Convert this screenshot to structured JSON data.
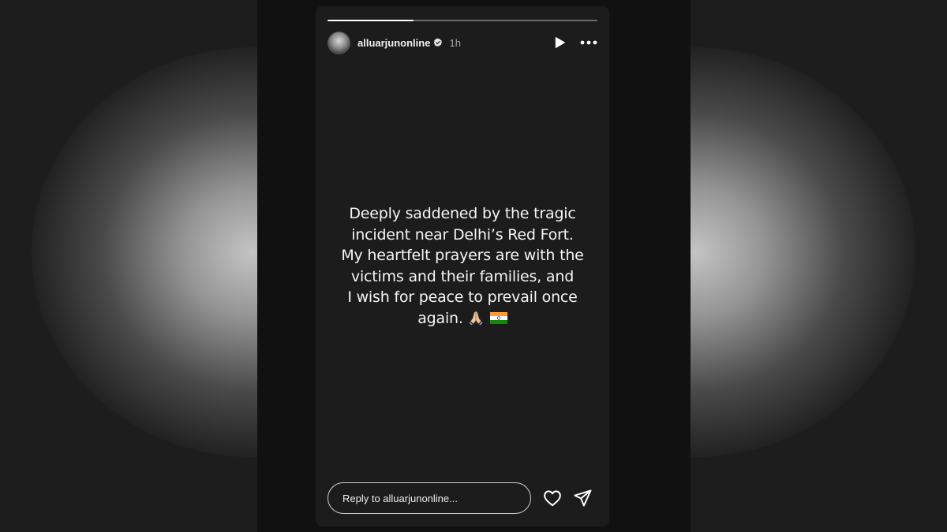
{
  "story": {
    "username": "alluarjunonline",
    "time_ago": "1h",
    "progress": 0.32,
    "text_lines": [
      "Deeply saddened by the tragic",
      "incident near Delhi’s Red Fort.",
      "My heartfelt prayers are with the",
      "victims and their families, and",
      "I wish for peace to prevail once",
      "again."
    ],
    "emojis": [
      "folded-hands",
      "india-flag"
    ]
  },
  "reply": {
    "placeholder": "Reply to alluarjunonline..."
  },
  "icons": {
    "play": "play-icon",
    "more": "more-options-icon",
    "like": "heart-icon",
    "share": "send-icon",
    "verified": "verified-badge-icon"
  },
  "colors": {
    "background": "#1c1c1c",
    "story_background": "#1c1c1c",
    "text": "#f5f5f5",
    "muted": "#a8a8a8"
  }
}
